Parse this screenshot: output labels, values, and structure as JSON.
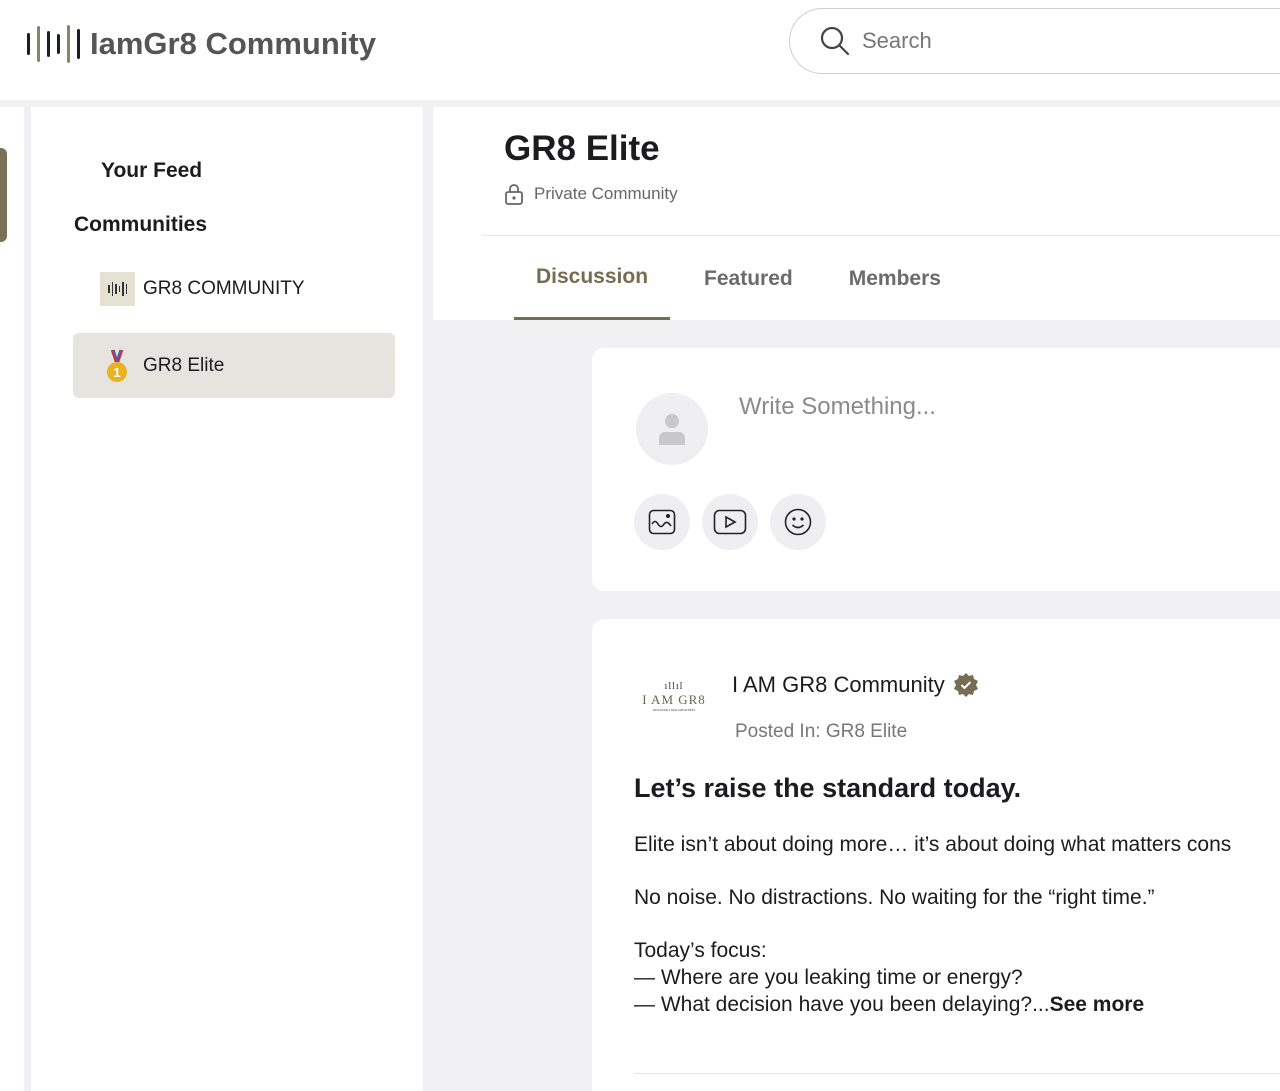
{
  "header": {
    "brand": "IamGr8 Community",
    "search_placeholder": "Search"
  },
  "sidebar": {
    "feed": "Your Feed",
    "communities_heading": "Communities",
    "items": [
      {
        "label": "GR8 COMMUNITY"
      },
      {
        "label": "GR8 Elite"
      }
    ]
  },
  "community": {
    "title": "GR8 Elite",
    "privacy": "Private Community",
    "tabs": [
      {
        "label": "Discussion"
      },
      {
        "label": "Featured"
      },
      {
        "label": "Members"
      }
    ]
  },
  "composer": {
    "placeholder": "Write Something..."
  },
  "post": {
    "logo_text": "I AM GR8",
    "logo_tagline": "DISCOVER YOUR GREATNESS",
    "author": "I AM GR8 Community",
    "posted_in": "Posted In: GR8 Elite",
    "title": "Let’s raise the standard today.",
    "p1": "Elite isn’t about doing more… it’s about doing what matters cons",
    "p2": "No noise. No distractions. No waiting for the “right time.”",
    "p3_head": "Today’s focus:",
    "p3_l1": "— Where are you leaking time or energy?",
    "p3_l2": "— What decision have you been delaying?...",
    "see_more": "See more"
  },
  "colors": {
    "accent": "#756c52",
    "background": "#f1f1f4"
  }
}
